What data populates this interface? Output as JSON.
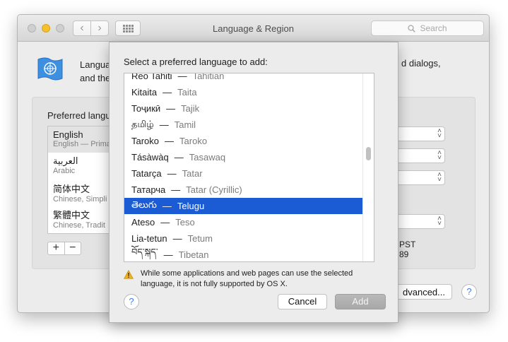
{
  "window": {
    "title": "Language & Region",
    "search_placeholder": "Search",
    "header_left_line1": "Langua",
    "header_left_line2": "and the",
    "header_right": "d dialogs,",
    "preferred_label": "Preferred langu",
    "languages": [
      {
        "name": "English",
        "sub": "English — Prima"
      },
      {
        "name": "العربية",
        "sub": "Arabic"
      },
      {
        "name": "简体中文",
        "sub": "Chinese, Simpli"
      },
      {
        "name": "繁體中文",
        "sub": "Chinese, Tradit"
      }
    ],
    "plus_label": "+",
    "minus_label": "−",
    "time_text": "PST",
    "number_text": "89",
    "advanced_label": "dvanced...",
    "help_label": "?"
  },
  "sheet": {
    "title": "Select a preferred language to add:",
    "rows": [
      {
        "native": "Reo Tahiti",
        "english": "Tahitian"
      },
      {
        "native": "Kitaita",
        "english": "Taita"
      },
      {
        "native": "Тоҷикӣ",
        "english": "Tajik"
      },
      {
        "native": "தமிழ்",
        "english": "Tamil"
      },
      {
        "native": "Taroko",
        "english": "Taroko"
      },
      {
        "native": "Tásàwàq",
        "english": "Tasawaq"
      },
      {
        "native": "Tatarça",
        "english": "Tatar"
      },
      {
        "native": "Татарча",
        "english": "Tatar (Cyrillic)"
      },
      {
        "native": "తెలుగు",
        "english": "Telugu"
      },
      {
        "native": "Ateso",
        "english": "Teso"
      },
      {
        "native": "Lia-tetun",
        "english": "Tetum"
      },
      {
        "native": "བོད་སྐད་",
        "english": "Tibetan"
      }
    ],
    "selected_index": 8,
    "dash": "—",
    "warning": "While some applications and web pages can use the selected language, it is not fully supported by OS X.",
    "help_label": "?",
    "cancel_label": "Cancel",
    "add_label": "Add"
  },
  "colors": {
    "selection": "#1b5cd5",
    "accent": "#3a7ee8",
    "warning": "#f2b21b"
  },
  "icons": {
    "globe": "un-flag-icon",
    "warning": "warning-triangle-icon",
    "search": "search-icon"
  }
}
